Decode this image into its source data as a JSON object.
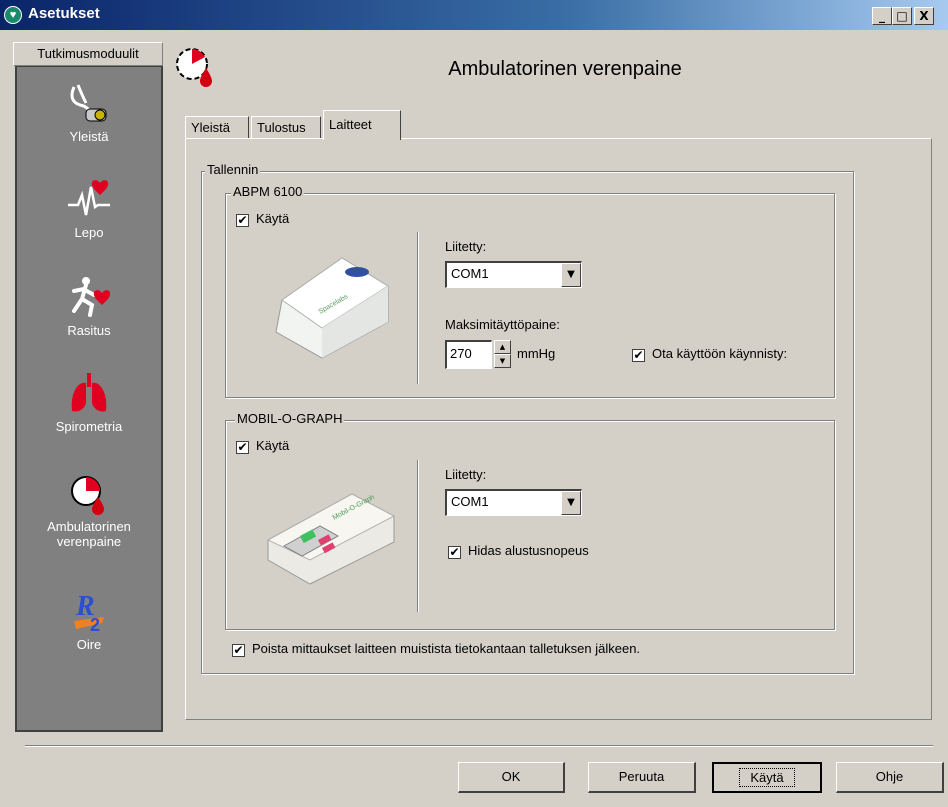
{
  "window": {
    "title": "Asetukset",
    "controls": {
      "minimize": "_",
      "maximize": "□",
      "close": "X"
    }
  },
  "sidebar": {
    "header": "Tutkimusmoduulit",
    "items": [
      {
        "label": "Yleistä",
        "icon": "stethoscope-icon"
      },
      {
        "label": "Lepo",
        "icon": "heartbeat-icon"
      },
      {
        "label": "Rasitus",
        "icon": "runner-heart-icon"
      },
      {
        "label": "Spirometria",
        "icon": "lungs-icon"
      },
      {
        "label": "Ambulatorinen\nverenpaine",
        "icon": "blood-pressure-clock-icon"
      },
      {
        "label": "Oire",
        "icon": "r2-logo-icon"
      }
    ]
  },
  "header": {
    "title": "Ambulatorinen verenpaine",
    "icon": "blood-pressure-clock-icon"
  },
  "tabs": [
    {
      "label": "Yleistä"
    },
    {
      "label": "Tulostus"
    },
    {
      "label": "Laitteet",
      "active": true
    }
  ],
  "recorder_group": {
    "legend": "Tallennin",
    "abpm": {
      "legend": "ABPM 6100",
      "use_label": "Käytä",
      "use_checked": true,
      "connected_label": "Liitetty:",
      "port_value": "COM1",
      "max_pressure_label": "Maksimitäyttöpaine:",
      "max_pressure_value": "270",
      "unit": "mmHg",
      "startup_label": "Ota käyttöön käynnisty:",
      "startup_checked": true
    },
    "mobil": {
      "legend": "MOBIL-O-GRAPH",
      "use_label": "Käytä",
      "use_checked": true,
      "connected_label": "Liitetty:",
      "port_value": "COM1",
      "slow_init_label": "Hidas alustusnopeus",
      "slow_init_checked": true
    },
    "delete_label": "Poista mittaukset laitteen muistista tietokantaan talletuksen jälkeen.",
    "delete_checked": true
  },
  "buttons": {
    "ok": "OK",
    "cancel": "Peruuta",
    "apply": "Käytä",
    "help": "Ohje"
  },
  "check_glyph": "✔"
}
